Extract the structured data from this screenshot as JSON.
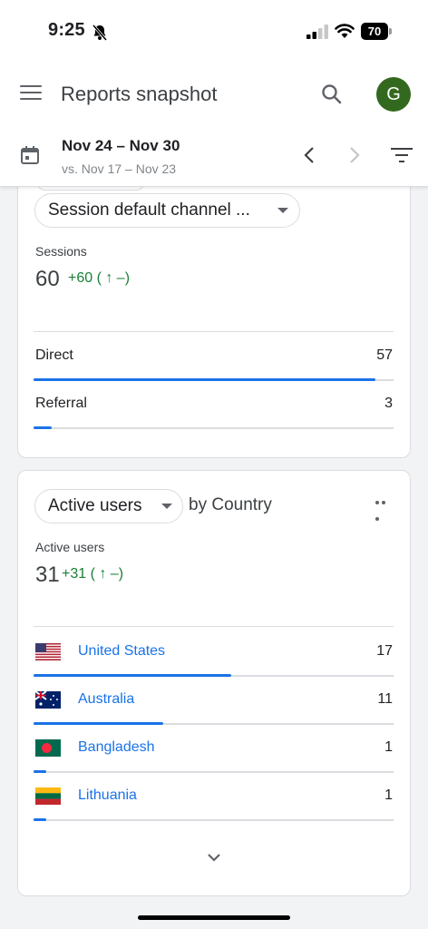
{
  "status": {
    "time": "9:25",
    "battery": "70"
  },
  "app_bar": {
    "title": "Reports snapshot",
    "avatar_letter": "G"
  },
  "date_bar": {
    "range": "Nov 24 – Nov 30",
    "compare": "vs. Nov 17 – Nov 23"
  },
  "colors": {
    "accent": "#1a73e8",
    "positive": "#188038",
    "avatar": "#33691e"
  },
  "card_channels": {
    "dimension_label": "Session default channel ...",
    "metric_label": "Sessions",
    "metric_value": "60",
    "metric_delta": "+60 ( ↑ –)",
    "rows": [
      {
        "label": "Direct",
        "value": "57",
        "fraction": 0.95
      },
      {
        "label": "Referral",
        "value": "3",
        "fraction": 0.05
      }
    ]
  },
  "card_country": {
    "metric_selector": "Active users",
    "by_text": "by Country",
    "metric_label": "Active users",
    "metric_value": "31",
    "metric_delta": "+31 ( ↑ –)",
    "rows": [
      {
        "label": "United States",
        "value": "17",
        "fraction": 0.55,
        "flag": "us-flag-icon"
      },
      {
        "label": "Australia",
        "value": "11",
        "fraction": 0.36,
        "flag": "au-flag-icon"
      },
      {
        "label": "Bangladesh",
        "value": "1",
        "fraction": 0.035,
        "flag": "bd-flag-icon"
      },
      {
        "label": "Lithuania",
        "value": "1",
        "fraction": 0.035,
        "flag": "lt-flag-icon"
      }
    ]
  }
}
